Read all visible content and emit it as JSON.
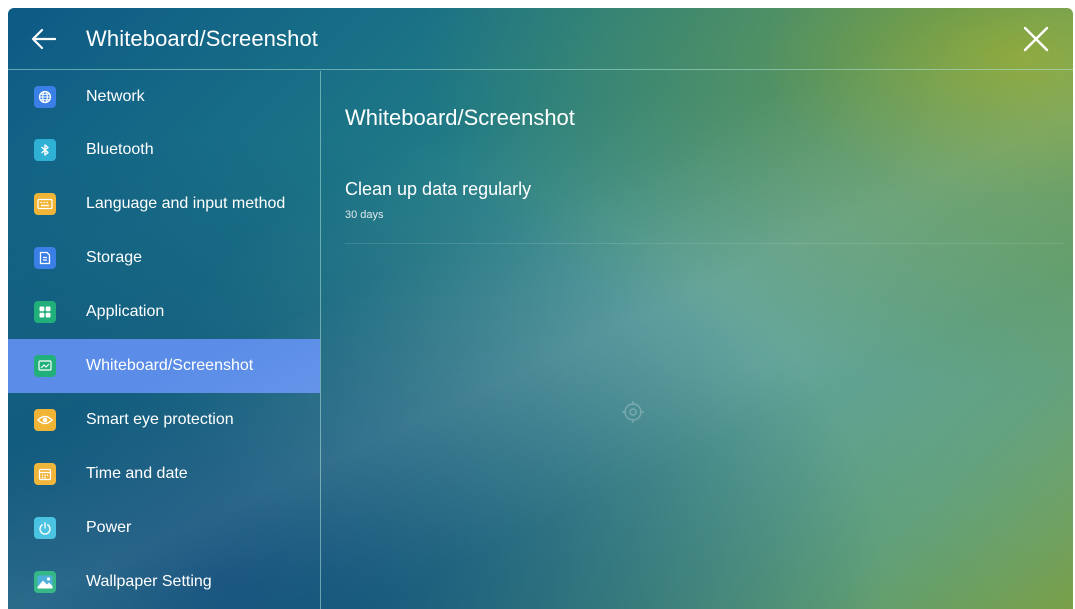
{
  "header": {
    "title": "Whiteboard/Screenshot",
    "back_icon": "arrow-left-icon",
    "close_icon": "close-icon"
  },
  "sidebar": {
    "items": [
      {
        "label": "Network",
        "icon": "globe-icon",
        "color": "#3a7fe6"
      },
      {
        "label": "Bluetooth",
        "icon": "bluetooth-icon",
        "color": "#2fb1d6"
      },
      {
        "label": "Language and input method",
        "icon": "keyboard-icon",
        "color": "#f0b436"
      },
      {
        "label": "Storage",
        "icon": "storage-icon",
        "color": "#3a7fe6"
      },
      {
        "label": "Application",
        "icon": "grid-icon",
        "color": "#22b07a"
      },
      {
        "label": "Whiteboard/Screenshot",
        "icon": "whiteboard-icon",
        "color": "#22b07a",
        "active": true
      },
      {
        "label": "Smart eye protection",
        "icon": "eye-icon",
        "color": "#f0b436"
      },
      {
        "label": "Time and date",
        "icon": "calendar-icon",
        "color": "#f0b436"
      },
      {
        "label": "Power",
        "icon": "power-icon",
        "color": "#3fc0e0"
      },
      {
        "label": "Wallpaper Setting",
        "icon": "image-icon",
        "color": "#22b07a"
      }
    ]
  },
  "main": {
    "title": "Whiteboard/Screenshot",
    "settings": [
      {
        "title": "Clean up data regularly",
        "value": "30 days"
      }
    ]
  },
  "colors": {
    "active_item": "#5b8de8",
    "divider": "#aae1d7"
  }
}
